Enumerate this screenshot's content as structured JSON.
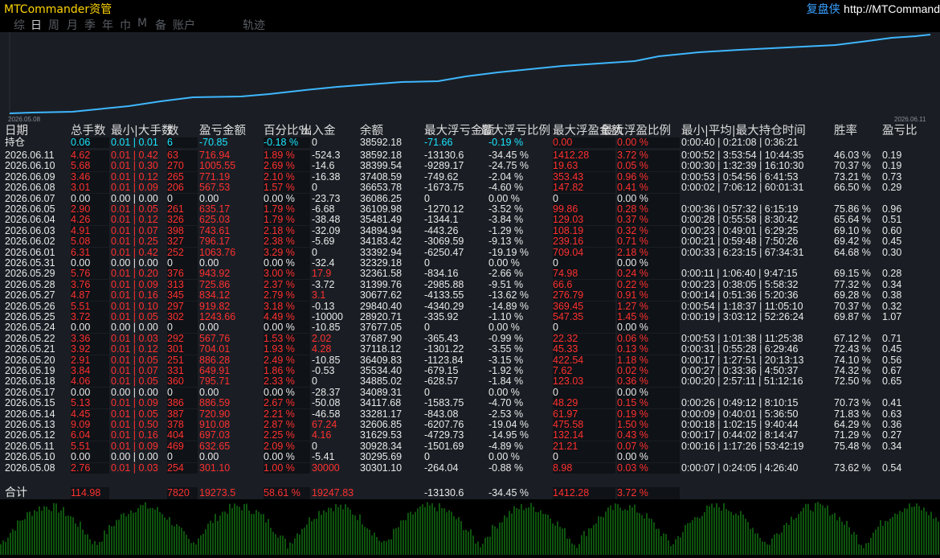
{
  "app": {
    "title": "MTCommander资管",
    "replay_label": "复盘侠",
    "url": "http://MTCommand"
  },
  "tabs": [
    "综",
    "日",
    "周",
    "月",
    "季",
    "年",
    "巾",
    "M",
    "备",
    "账户",
    "轨迹"
  ],
  "active_tab": "日",
  "equity_chart": {
    "start_date": "2026.05.08",
    "end_date": "2026.06.11",
    "line_color": "#3fb7ff",
    "values": [
      30301.1,
      30295.69,
      30928.34,
      31629.53,
      32606.85,
      33281.17,
      34117.68,
      34089.31,
      34885.02,
      35534.4,
      36409.83,
      37118.12,
      37687.9,
      37677.05,
      28920.71,
      29840.4,
      30677.62,
      31399.76,
      32361.58,
      32329.18,
      33392.94,
      34183.42,
      34894.94,
      35481.49,
      36109.98,
      36086.25,
      36653.78,
      37408.59,
      38399.54,
      38592.18
    ]
  },
  "columns": [
    "日期",
    "总手数",
    "最小|大手数",
    "数",
    "盈亏金额",
    "百分比%",
    "出入金",
    "余额",
    "最大浮亏金额",
    "最大浮亏比例",
    "最大浮盈金额",
    "最大浮盈比例",
    "最小|平均|最大持仓时间",
    "胜率",
    "盈亏比"
  ],
  "holding": {
    "label": "持仓",
    "lots": "0.06",
    "minmax": "0.01 | 0.01",
    "count": "6",
    "pnl": "-70.85",
    "pct": "-0.18 %",
    "flow": "0",
    "balance": "38592.18",
    "dd_amt": "-71.66",
    "dd_pct": "-0.19 %",
    "fp_amt": "0.00",
    "fp_pct": "0.00 %",
    "times": "0:00:40 | 0:21:08 | 0:36:21",
    "win": "",
    "pf": ""
  },
  "rows": [
    {
      "date": "2026.06.11",
      "lots": "4.62",
      "minmax": "0.01 | 0.42",
      "count": "63",
      "pnl": "716.94",
      "pct": "1.89 %",
      "flow": "-524.3",
      "balance": "38592.18",
      "dd_amt": "-13130.6",
      "dd_pct": "-34.45 %",
      "fp_amt": "1412.28",
      "fp_pct": "3.72 %",
      "times": "0:00:52 | 3:53:54 | 10:44:35",
      "win": "46.03 %",
      "pf": "0.19"
    },
    {
      "date": "2026.06.10",
      "lots": "5.68",
      "minmax": "0.01 | 0.30",
      "count": "270",
      "pnl": "1005.55",
      "pct": "2.69 %",
      "flow": "-14.6",
      "balance": "38399.54",
      "dd_amt": "-9289.17",
      "dd_pct": "-24.75 %",
      "fp_amt": "19.63",
      "fp_pct": "0.05 %",
      "times": "0:00:30 | 1:32:39 | 16:10:30",
      "win": "70.37 %",
      "pf": "0.19"
    },
    {
      "date": "2026.06.09",
      "lots": "3.46",
      "minmax": "0.01 | 0.12",
      "count": "265",
      "pnl": "771.19",
      "pct": "2.10 %",
      "flow": "-16.38",
      "balance": "37408.59",
      "dd_amt": "-749.62",
      "dd_pct": "-2.04 %",
      "fp_amt": "353.43",
      "fp_pct": "0.96 %",
      "times": "0:00:53 | 0:54:56 | 6:41:53",
      "win": "73.21 %",
      "pf": "0.73"
    },
    {
      "date": "2026.06.08",
      "lots": "3.01",
      "minmax": "0.01 | 0.09",
      "count": "206",
      "pnl": "567.53",
      "pct": "1.57 %",
      "flow": "0",
      "balance": "36653.78",
      "dd_amt": "-1673.75",
      "dd_pct": "-4.60 %",
      "fp_amt": "147.82",
      "fp_pct": "0.41 %",
      "times": "0:00:02 | 7:06:12 | 60:01:31",
      "win": "66.50 %",
      "pf": "0.29"
    },
    {
      "date": "2026.06.07",
      "lots": "0.00",
      "minmax": "0.00 | 0.00",
      "count": "0",
      "pnl": "0.00",
      "pct": "0.00 %",
      "flow": "-23.73",
      "balance": "36086.25",
      "dd_amt": "0",
      "dd_pct": "0.00 %",
      "fp_amt": "0",
      "fp_pct": "0.00 %",
      "times": "",
      "win": "",
      "pf": ""
    },
    {
      "date": "2026.06.05",
      "lots": "2.90",
      "minmax": "0.01 | 0.05",
      "count": "261",
      "pnl": "635.17",
      "pct": "1.79 %",
      "flow": "-6.68",
      "balance": "36109.98",
      "dd_amt": "-1270.12",
      "dd_pct": "-3.52 %",
      "fp_amt": "99.86",
      "fp_pct": "0.28 %",
      "times": "0:00:36 | 0:57:32 | 6:15:19",
      "win": "75.86 %",
      "pf": "0.96"
    },
    {
      "date": "2026.06.04",
      "lots": "4.26",
      "minmax": "0.01 | 0.12",
      "count": "326",
      "pnl": "625.03",
      "pct": "1.79 %",
      "flow": "-38.48",
      "balance": "35481.49",
      "dd_amt": "-1344.1",
      "dd_pct": "-3.84 %",
      "fp_amt": "129.03",
      "fp_pct": "0.37 %",
      "times": "0:00:28 | 0:55:58 | 8:30:42",
      "win": "65.64 %",
      "pf": "0.51"
    },
    {
      "date": "2026.06.03",
      "lots": "4.91",
      "minmax": "0.01 | 0.07",
      "count": "398",
      "pnl": "743.61",
      "pct": "2.18 %",
      "flow": "-32.09",
      "balance": "34894.94",
      "dd_amt": "-443.26",
      "dd_pct": "-1.29 %",
      "fp_amt": "108.19",
      "fp_pct": "0.32 %",
      "times": "0:00:23 | 0:49:01 | 6:29:25",
      "win": "69.10 %",
      "pf": "0.60"
    },
    {
      "date": "2026.06.02",
      "lots": "5.08",
      "minmax": "0.01 | 0.25",
      "count": "327",
      "pnl": "796.17",
      "pct": "2.38 %",
      "flow": "-5.69",
      "balance": "34183.42",
      "dd_amt": "-3069.59",
      "dd_pct": "-9.13 %",
      "fp_amt": "239.16",
      "fp_pct": "0.71 %",
      "times": "0:00:21 | 0:59:48 | 7:50:26",
      "win": "69.42 %",
      "pf": "0.45"
    },
    {
      "date": "2026.06.01",
      "lots": "6.31",
      "minmax": "0.01 | 0.42",
      "count": "252",
      "pnl": "1063.76",
      "pct": "3.29 %",
      "flow": "0",
      "balance": "33392.94",
      "dd_amt": "-6250.47",
      "dd_pct": "-19.19 %",
      "fp_amt": "709.04",
      "fp_pct": "2.18 %",
      "times": "0:00:33 | 6:23:15 | 67:34:31",
      "win": "64.68 %",
      "pf": "0.30"
    },
    {
      "date": "2026.05.31",
      "lots": "0.00",
      "minmax": "0.00 | 0.00",
      "count": "0",
      "pnl": "0.00",
      "pct": "0.00 %",
      "flow": "-32.4",
      "balance": "32329.18",
      "dd_amt": "0",
      "dd_pct": "0.00 %",
      "fp_amt": "0",
      "fp_pct": "0.00 %",
      "times": "",
      "win": "",
      "pf": ""
    },
    {
      "date": "2026.05.29",
      "lots": "5.76",
      "minmax": "0.01 | 0.20",
      "count": "376",
      "pnl": "943.92",
      "pct": "3.00 %",
      "flow": "17.9",
      "balance": "32361.58",
      "dd_amt": "-834.16",
      "dd_pct": "-2.66 %",
      "fp_amt": "74.98",
      "fp_pct": "0.24 %",
      "times": "0:00:11 | 1:06:40 | 9:47:15",
      "win": "69.15 %",
      "pf": "0.28"
    },
    {
      "date": "2026.05.28",
      "lots": "3.76",
      "minmax": "0.01 | 0.09",
      "count": "313",
      "pnl": "725.86",
      "pct": "2.37 %",
      "flow": "-3.72",
      "balance": "31399.76",
      "dd_amt": "-2985.88",
      "dd_pct": "-9.51 %",
      "fp_amt": "66.6",
      "fp_pct": "0.22 %",
      "times": "0:00:23 | 0:38:05 | 5:58:32",
      "win": "77.32 %",
      "pf": "0.34"
    },
    {
      "date": "2026.05.27",
      "lots": "4.87",
      "minmax": "0.01 | 0.16",
      "count": "345",
      "pnl": "834.12",
      "pct": "2.79 %",
      "flow": "3.1",
      "balance": "30677.62",
      "dd_amt": "-4133.55",
      "dd_pct": "-13.62 %",
      "fp_amt": "276.79",
      "fp_pct": "0.91 %",
      "times": "0:00:14 | 0:51:36 | 5:20:36",
      "win": "69.28 %",
      "pf": "0.38"
    },
    {
      "date": "2026.05.26",
      "lots": "5.51",
      "minmax": "0.01 | 0.10",
      "count": "297",
      "pnl": "919.82",
      "pct": "3.18 %",
      "flow": "-0.13",
      "balance": "29840.40",
      "dd_amt": "-4340.29",
      "dd_pct": "-14.89 %",
      "fp_amt": "369.45",
      "fp_pct": "1.27 %",
      "times": "0:00:54 | 1:18:37 | 11:05:10",
      "win": "70.37 %",
      "pf": "0.32"
    },
    {
      "date": "2026.05.25",
      "lots": "3.72",
      "minmax": "0.01 | 0.05",
      "count": "302",
      "pnl": "1243.66",
      "pct": "4.49 %",
      "flow": "-10000",
      "balance": "28920.71",
      "dd_amt": "-335.92",
      "dd_pct": "-1.10 %",
      "fp_amt": "547.35",
      "fp_pct": "1.45 %",
      "times": "0:00:19 | 3:03:12 | 52:26:24",
      "win": "69.87 %",
      "pf": "1.07"
    },
    {
      "date": "2026.05.24",
      "lots": "0.00",
      "minmax": "0.00 | 0.00",
      "count": "0",
      "pnl": "0.00",
      "pct": "0.00 %",
      "flow": "-10.85",
      "balance": "37677.05",
      "dd_amt": "0",
      "dd_pct": "0.00 %",
      "fp_amt": "0",
      "fp_pct": "0.00 %",
      "times": "",
      "win": "",
      "pf": ""
    },
    {
      "date": "2026.05.22",
      "lots": "3.36",
      "minmax": "0.01 | 0.03",
      "count": "292",
      "pnl": "567.76",
      "pct": "1.53 %",
      "flow": "2.02",
      "balance": "37687.90",
      "dd_amt": "-365.43",
      "dd_pct": "-0.99 %",
      "fp_amt": "22.32",
      "fp_pct": "0.06 %",
      "times": "0:00:53 | 1:01:38 | 11:25:38",
      "win": "67.12 %",
      "pf": "0.71"
    },
    {
      "date": "2026.05.21",
      "lots": "3.92",
      "minmax": "0.01 | 0.12",
      "count": "301",
      "pnl": "704.01",
      "pct": "1.93 %",
      "flow": "4.28",
      "balance": "37118.12",
      "dd_amt": "-1301.22",
      "dd_pct": "-3.55 %",
      "fp_amt": "45.33",
      "fp_pct": "0.13 %",
      "times": "0:00:31 | 0:55:28 | 6:29:46",
      "win": "72.43 %",
      "pf": "0.45"
    },
    {
      "date": "2026.05.20",
      "lots": "2.91",
      "minmax": "0.01 | 0.05",
      "count": "251",
      "pnl": "886.28",
      "pct": "2.49 %",
      "flow": "-10.85",
      "balance": "36409.83",
      "dd_amt": "-1123.84",
      "dd_pct": "-3.15 %",
      "fp_amt": "422.54",
      "fp_pct": "1.18 %",
      "times": "0:00:17 | 1:27:51 | 20:13:13",
      "win": "74.10 %",
      "pf": "0.56"
    },
    {
      "date": "2026.05.19",
      "lots": "3.84",
      "minmax": "0.01 | 0.07",
      "count": "331",
      "pnl": "649.91",
      "pct": "1.86 %",
      "flow": "-0.53",
      "balance": "35534.40",
      "dd_amt": "-679.15",
      "dd_pct": "-1.92 %",
      "fp_amt": "7.62",
      "fp_pct": "0.02 %",
      "times": "0:00:27 | 0:33:36 | 4:50:37",
      "win": "74.32 %",
      "pf": "0.67"
    },
    {
      "date": "2026.05.18",
      "lots": "4.06",
      "minmax": "0.01 | 0.05",
      "count": "360",
      "pnl": "795.71",
      "pct": "2.33 %",
      "flow": "0",
      "balance": "34885.02",
      "dd_amt": "-628.57",
      "dd_pct": "-1.84 %",
      "fp_amt": "123.03",
      "fp_pct": "0.36 %",
      "times": "0:00:20 | 2:57:11 | 51:12:16",
      "win": "72.50 %",
      "pf": "0.65"
    },
    {
      "date": "2026.05.17",
      "lots": "0.00",
      "minmax": "0.00 | 0.00",
      "count": "0",
      "pnl": "0.00",
      "pct": "0.00 %",
      "flow": "-28.37",
      "balance": "34089.31",
      "dd_amt": "0",
      "dd_pct": "0.00 %",
      "fp_amt": "0",
      "fp_pct": "0.00 %",
      "times": "",
      "win": "",
      "pf": ""
    },
    {
      "date": "2026.05.15",
      "lots": "5.13",
      "minmax": "0.01 | 0.09",
      "count": "386",
      "pnl": "886.59",
      "pct": "2.67 %",
      "flow": "-50.08",
      "balance": "34117.68",
      "dd_amt": "-1583.75",
      "dd_pct": "-4.70 %",
      "fp_amt": "48.29",
      "fp_pct": "0.15 %",
      "times": "0:00:26 | 0:49:12 | 8:10:15",
      "win": "70.73 %",
      "pf": "0.41"
    },
    {
      "date": "2026.05.14",
      "lots": "4.45",
      "minmax": "0.01 | 0.05",
      "count": "387",
      "pnl": "720.90",
      "pct": "2.21 %",
      "flow": "-46.58",
      "balance": "33281.17",
      "dd_amt": "-843.08",
      "dd_pct": "-2.53 %",
      "fp_amt": "61.97",
      "fp_pct": "0.19 %",
      "times": "0:00:09 | 0:40:01 | 5:36:50",
      "win": "71.83 %",
      "pf": "0.63"
    },
    {
      "date": "2026.05.13",
      "lots": "9.09",
      "minmax": "0.01 | 0.50",
      "count": "378",
      "pnl": "910.08",
      "pct": "2.87 %",
      "flow": "67.24",
      "balance": "32606.85",
      "dd_amt": "-6207.76",
      "dd_pct": "-19.04 %",
      "fp_amt": "475.58",
      "fp_pct": "1.50 %",
      "times": "0:00:18 | 1:02:15 | 9:40:44",
      "win": "64.29 %",
      "pf": "0.36"
    },
    {
      "date": "2026.05.12",
      "lots": "6.04",
      "minmax": "0.01 | 0.16",
      "count": "404",
      "pnl": "697.03",
      "pct": "2.25 %",
      "flow": "4.16",
      "balance": "31629.53",
      "dd_amt": "-4729.73",
      "dd_pct": "-14.95 %",
      "fp_amt": "132.14",
      "fp_pct": "0.43 %",
      "times": "0:00:17 | 0:44:02 | 8:14:47",
      "win": "71.29 %",
      "pf": "0.27"
    },
    {
      "date": "2026.05.11",
      "lots": "5.51",
      "minmax": "0.01 | 0.09",
      "count": "469",
      "pnl": "632.65",
      "pct": "2.09 %",
      "flow": "0",
      "balance": "30928.34",
      "dd_amt": "-1501.69",
      "dd_pct": "-4.89 %",
      "fp_amt": "21.21",
      "fp_pct": "0.07 %",
      "times": "0:00:16 | 1:17:26 | 53:42:19",
      "win": "75.48 %",
      "pf": "0.34"
    },
    {
      "date": "2026.05.10",
      "lots": "0.00",
      "minmax": "0.00 | 0.00",
      "count": "0",
      "pnl": "0.00",
      "pct": "0.00 %",
      "flow": "-5.41",
      "balance": "30295.69",
      "dd_amt": "0",
      "dd_pct": "0.00 %",
      "fp_amt": "0",
      "fp_pct": "0.00 %",
      "times": "",
      "win": "",
      "pf": ""
    },
    {
      "date": "2026.05.08",
      "lots": "2.76",
      "minmax": "0.01 | 0.03",
      "count": "254",
      "pnl": "301.10",
      "pct": "1.00 %",
      "flow": "30000",
      "balance": "30301.10",
      "dd_amt": "-264.04",
      "dd_pct": "-0.88 %",
      "fp_amt": "8.98",
      "fp_pct": "0.03 %",
      "times": "0:00:07 | 0:24:05 | 4:26:40",
      "win": "73.62 %",
      "pf": "0.54"
    }
  ],
  "total": {
    "label": "合计",
    "lots": "114.98",
    "count": "7820",
    "pnl": "19273.5",
    "pct": "58.61 %",
    "flow": "19247.83",
    "dd_amt": "-13130.6",
    "dd_pct": "-34.45 %",
    "fp_amt": "1412.28",
    "fp_pct": "3.72 %"
  },
  "colors": {
    "positive": "#ff3030",
    "neutral": "#e9e9e9",
    "holding": "#19e5ff",
    "volume": "#22c722",
    "panel_bg": "#1a1e24"
  }
}
